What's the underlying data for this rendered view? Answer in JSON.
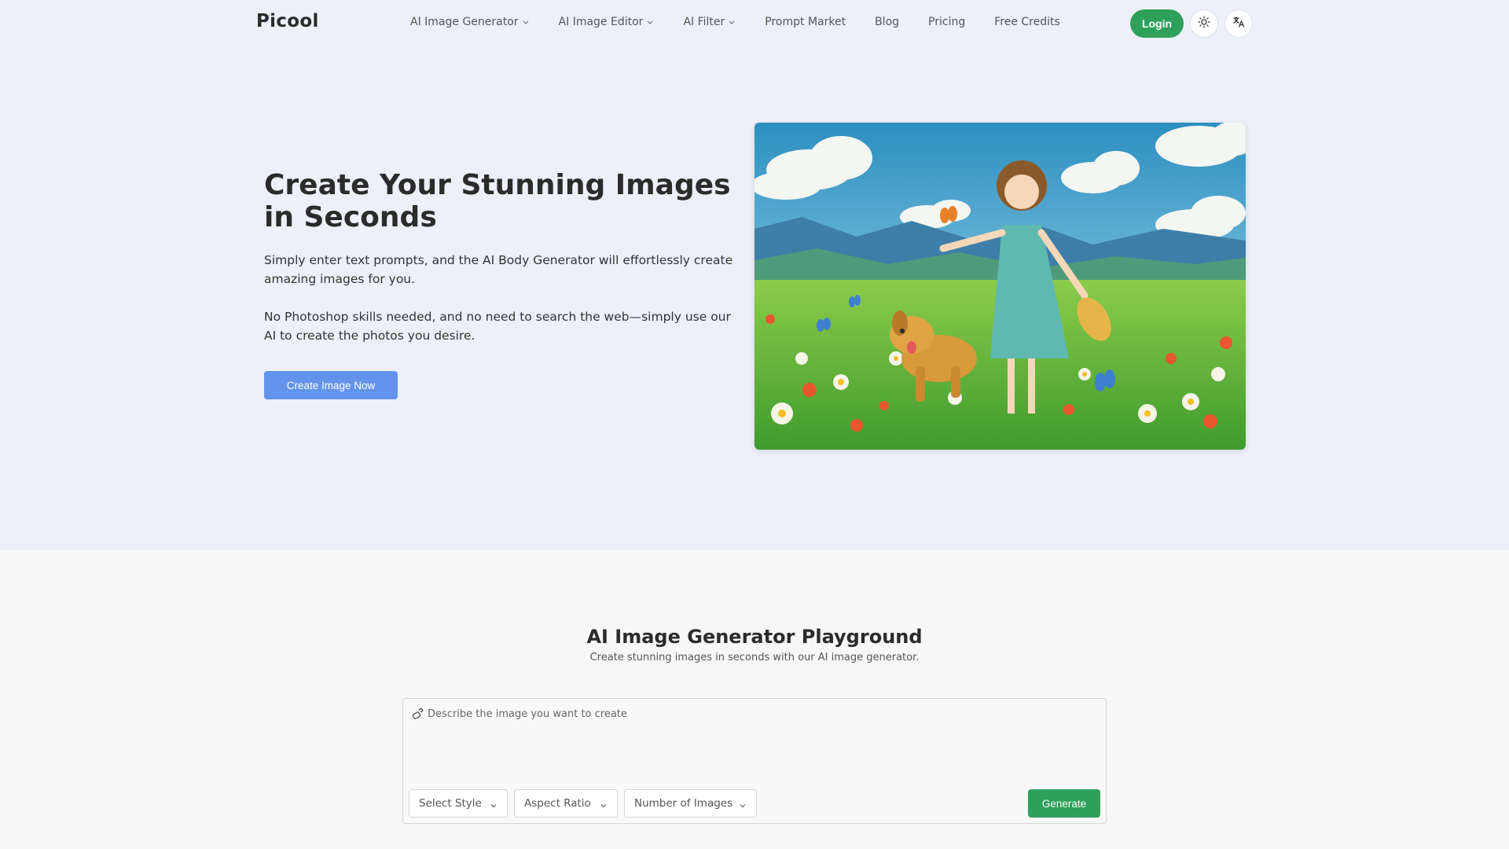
{
  "nav": {
    "logo": "Picool",
    "items": [
      {
        "label": "AI Image Generator",
        "dropdown": true
      },
      {
        "label": "AI Image Editor",
        "dropdown": true
      },
      {
        "label": "AI Filter",
        "dropdown": true
      },
      {
        "label": "Prompt Market",
        "dropdown": false
      },
      {
        "label": "Blog",
        "dropdown": false
      },
      {
        "label": "Pricing",
        "dropdown": false
      },
      {
        "label": "Free Credits",
        "dropdown": false
      }
    ],
    "login_label": "Login",
    "theme_icon": "sun-icon",
    "language_icon": "translate-icon"
  },
  "hero": {
    "title": "Create Your Stunning Images in Seconds",
    "paragraph1": "Simply enter text prompts, and the AI Body Generator will effortlessly create amazing images for you.",
    "paragraph2": "No Photoshop skills needed, and no need to search the web—simply use our AI to create the photos you desire.",
    "cta_label": "Create Image Now",
    "image_subject": "anime-style girl in teal dress with golden dog in flower meadow"
  },
  "playground": {
    "title": "AI Image Generator Playground",
    "subtitle": "Create stunning images in seconds with our AI image generator.",
    "prompt_placeholder": "Describe the image you want to create",
    "prompt_icon": "magic-wand-icon",
    "style_label": "Select Style",
    "ratio_label": "Aspect Ratio",
    "count_label": "Number of Images",
    "generate_label": "Generate"
  },
  "colors": {
    "accent_green": "#2ea05a",
    "cta_blue": "#6393ea",
    "hero_bg": "#edf0f8"
  }
}
